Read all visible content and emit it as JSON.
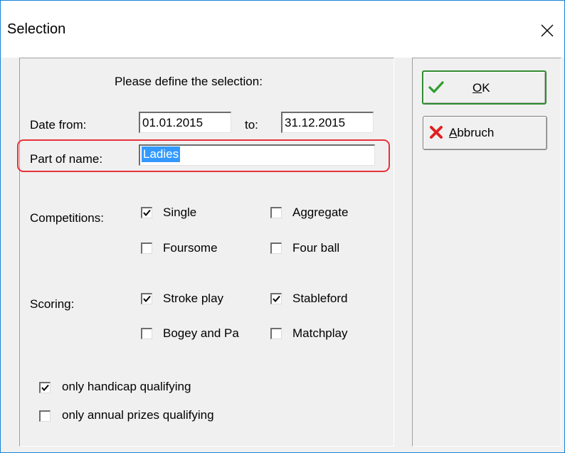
{
  "window": {
    "title": "Selection"
  },
  "prompt": "Please define the selection:",
  "date": {
    "from_label": "Date from:",
    "from_value": "01.01.2015",
    "to_label": "to:",
    "to_value": "31.12.2015"
  },
  "name": {
    "label": "Part of name:",
    "value": "Ladies"
  },
  "competitions": {
    "label": "Competitions:",
    "options": [
      {
        "label": "Single",
        "checked": true
      },
      {
        "label": "Aggregate",
        "checked": false
      },
      {
        "label": "Foursome",
        "checked": false
      },
      {
        "label": "Four ball",
        "checked": false
      }
    ]
  },
  "scoring": {
    "label": "Scoring:",
    "options": [
      {
        "label": "Stroke play",
        "checked": true
      },
      {
        "label": "Stableford",
        "checked": true
      },
      {
        "label": "Bogey and Pa",
        "checked": false
      },
      {
        "label": "Matchplay",
        "checked": false
      }
    ]
  },
  "qualifying": {
    "handicap": {
      "label": "only handicap qualifying",
      "checked": true
    },
    "annual": {
      "label": "only annual prizes qualifying",
      "checked": false
    }
  },
  "buttons": {
    "ok": {
      "label": "OK",
      "mnemonic": "O",
      "rest": "K",
      "icon": "checkmark-icon"
    },
    "cancel": {
      "label": "Abbruch",
      "mnemonic": "A",
      "rest": "bbruch",
      "icon": "red-x-icon"
    }
  },
  "colors": {
    "highlight_outline": "#e8323a",
    "selection": "#3399ff",
    "ok_icon": "#2e9e2e",
    "cancel_icon": "#e02020"
  }
}
